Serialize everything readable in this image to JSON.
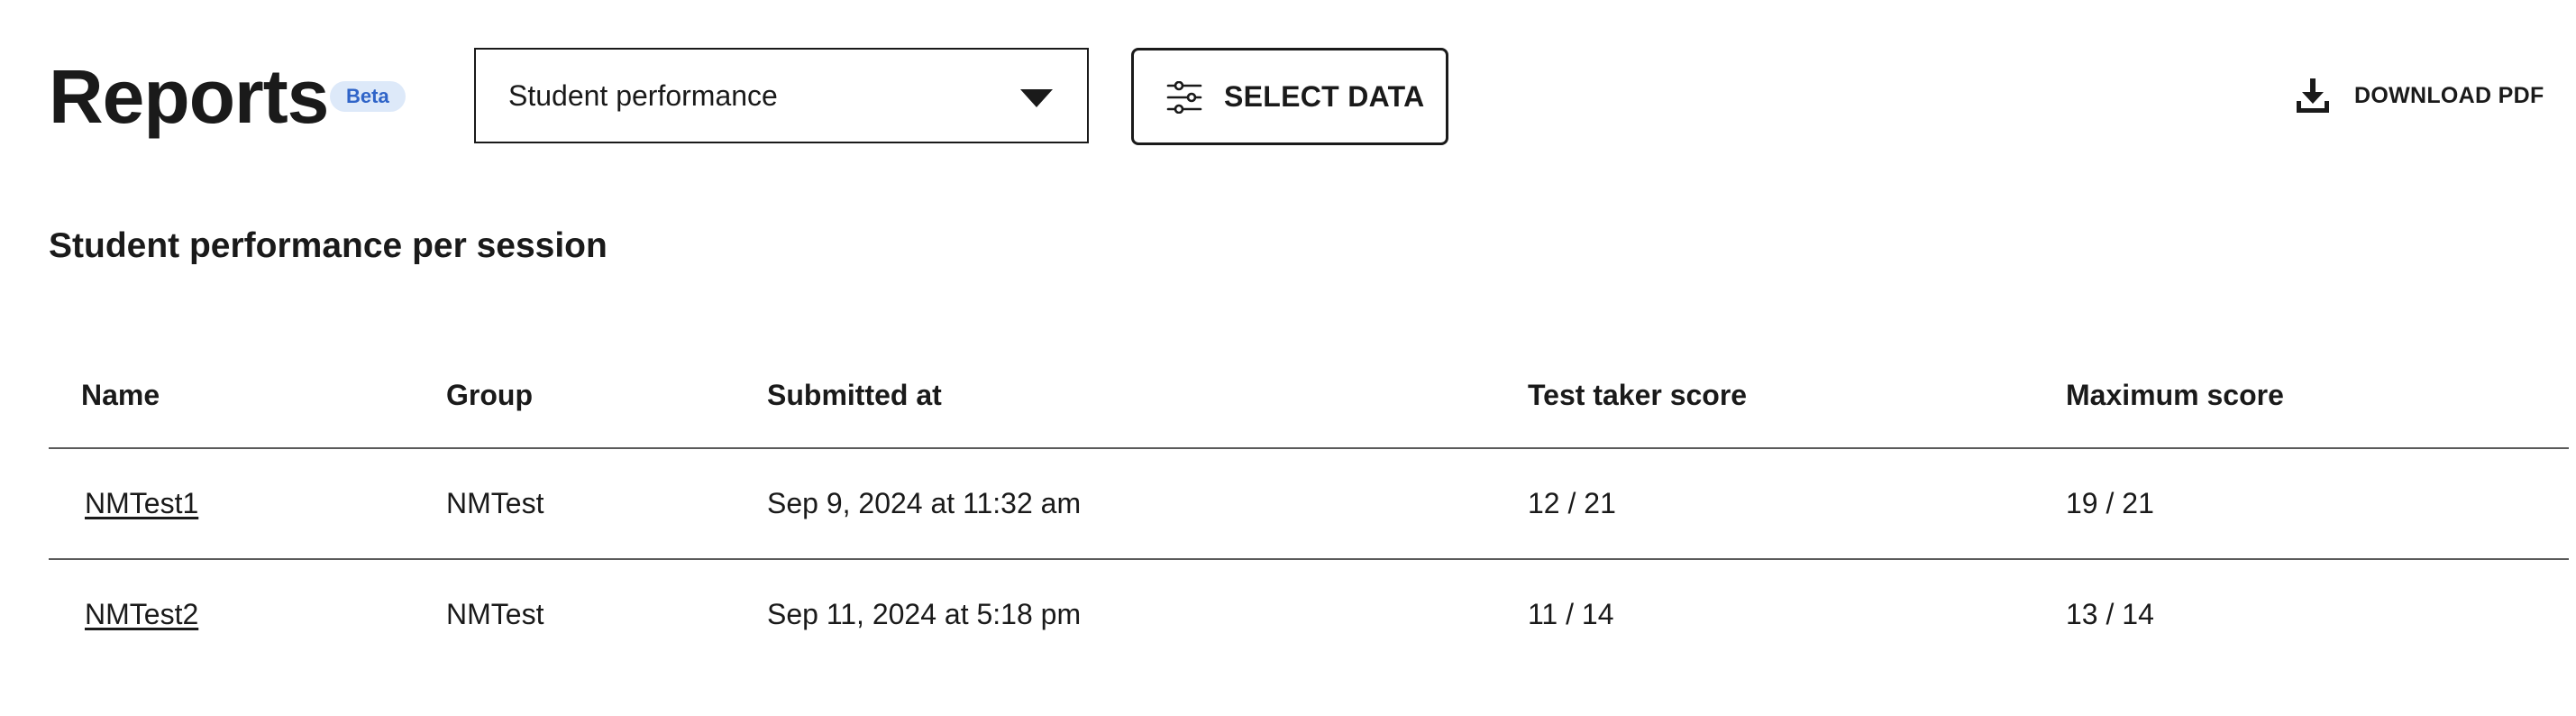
{
  "header": {
    "title": "Reports",
    "badge": "Beta",
    "report_select": {
      "value": "Student performance"
    },
    "select_data_label": "SELECT DATA",
    "download_label": "DOWNLOAD PDF"
  },
  "section": {
    "title": "Student performance per session"
  },
  "table": {
    "columns": [
      "Name",
      "Group",
      "Submitted at",
      "Test taker score",
      "Maximum score"
    ],
    "rows": [
      {
        "name": "NMTest1",
        "group": "NMTest",
        "submitted_at": "Sep 9, 2024 at 11:32 am",
        "test_taker_score": "12 / 21",
        "maximum_score": "19 / 21"
      },
      {
        "name": "NMTest2",
        "group": "NMTest",
        "submitted_at": "Sep 11, 2024 at 5:18 pm",
        "test_taker_score": "11 / 14",
        "maximum_score": "13 / 14"
      }
    ]
  },
  "icons": {
    "select_caret": "chevron-down-icon",
    "select_data": "sliders-icon",
    "download": "download-icon"
  },
  "colors": {
    "text": "#1a1a1a",
    "badge_bg": "#dde9f9",
    "badge_text": "#2f64c8",
    "divider": "#5a5a5a"
  }
}
